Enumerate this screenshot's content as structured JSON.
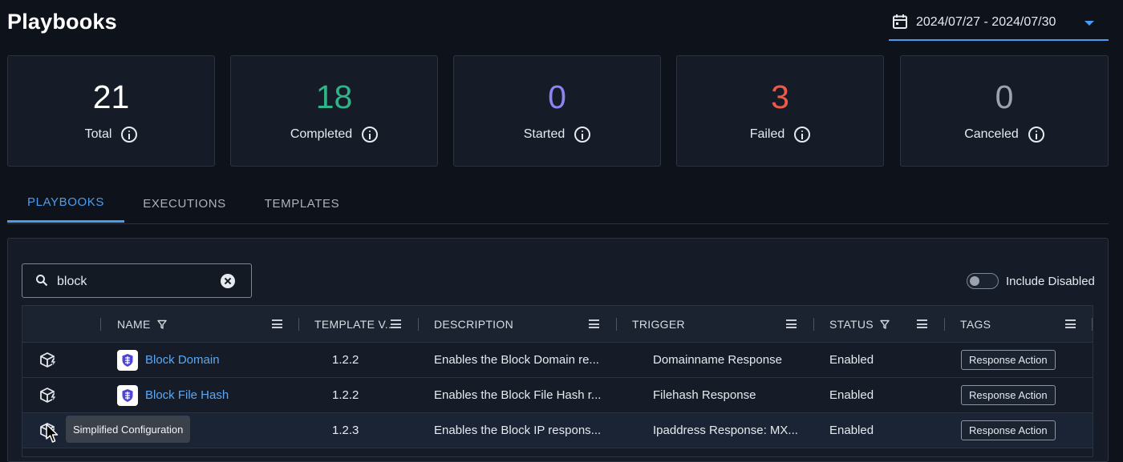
{
  "header": {
    "title": "Playbooks",
    "date_range": "2024/07/27 - 2024/07/30"
  },
  "stats": [
    {
      "value": "21",
      "label": "Total",
      "color": "#ffffff"
    },
    {
      "value": "18",
      "label": "Completed",
      "color": "#2fb489"
    },
    {
      "value": "0",
      "label": "Started",
      "color": "#8b84f2"
    },
    {
      "value": "3",
      "label": "Failed",
      "color": "#f0584a"
    },
    {
      "value": "0",
      "label": "Canceled",
      "color": "#9ba3ae"
    }
  ],
  "tabs": [
    {
      "label": "PLAYBOOKS",
      "active": true
    },
    {
      "label": "EXECUTIONS",
      "active": false
    },
    {
      "label": "TEMPLATES",
      "active": false
    }
  ],
  "search": {
    "value": "block"
  },
  "toggle": {
    "label": "Include Disabled",
    "on": false
  },
  "table": {
    "columns": [
      "NAME",
      "TEMPLATE V...",
      "DESCRIPTION",
      "TRIGGER",
      "STATUS",
      "TAGS"
    ],
    "rows": [
      {
        "name": "Block Domain",
        "version": "1.2.2",
        "description": "Enables the Block Domain re...",
        "trigger": "Domainname Response",
        "status": "Enabled",
        "tag": "Response Action"
      },
      {
        "name": "Block File Hash",
        "version": "1.2.2",
        "description": "Enables the Block File Hash r...",
        "trigger": "Filehash Response",
        "status": "Enabled",
        "tag": "Response Action"
      },
      {
        "name": "",
        "version": "1.2.3",
        "description": "Enables the Block IP respons...",
        "trigger": "Ipaddress Response: MX...",
        "status": "Enabled",
        "tag": "Response Action"
      }
    ]
  },
  "tooltip": {
    "text": "Simplified Configuration"
  },
  "icons": {
    "calendar": "calendar-icon",
    "dropdown": "chevron-down-icon",
    "info": "info-icon",
    "search": "search-icon",
    "clear": "clear-icon",
    "filter": "filter-icon",
    "menu": "column-menu-icon",
    "config": "cube-bolt-icon",
    "playbook": "shield-logo-icon"
  },
  "colors": {
    "accent": "#4b9cf0",
    "link": "#5aa8f5",
    "background": "#0e131b",
    "card": "#151c27"
  }
}
